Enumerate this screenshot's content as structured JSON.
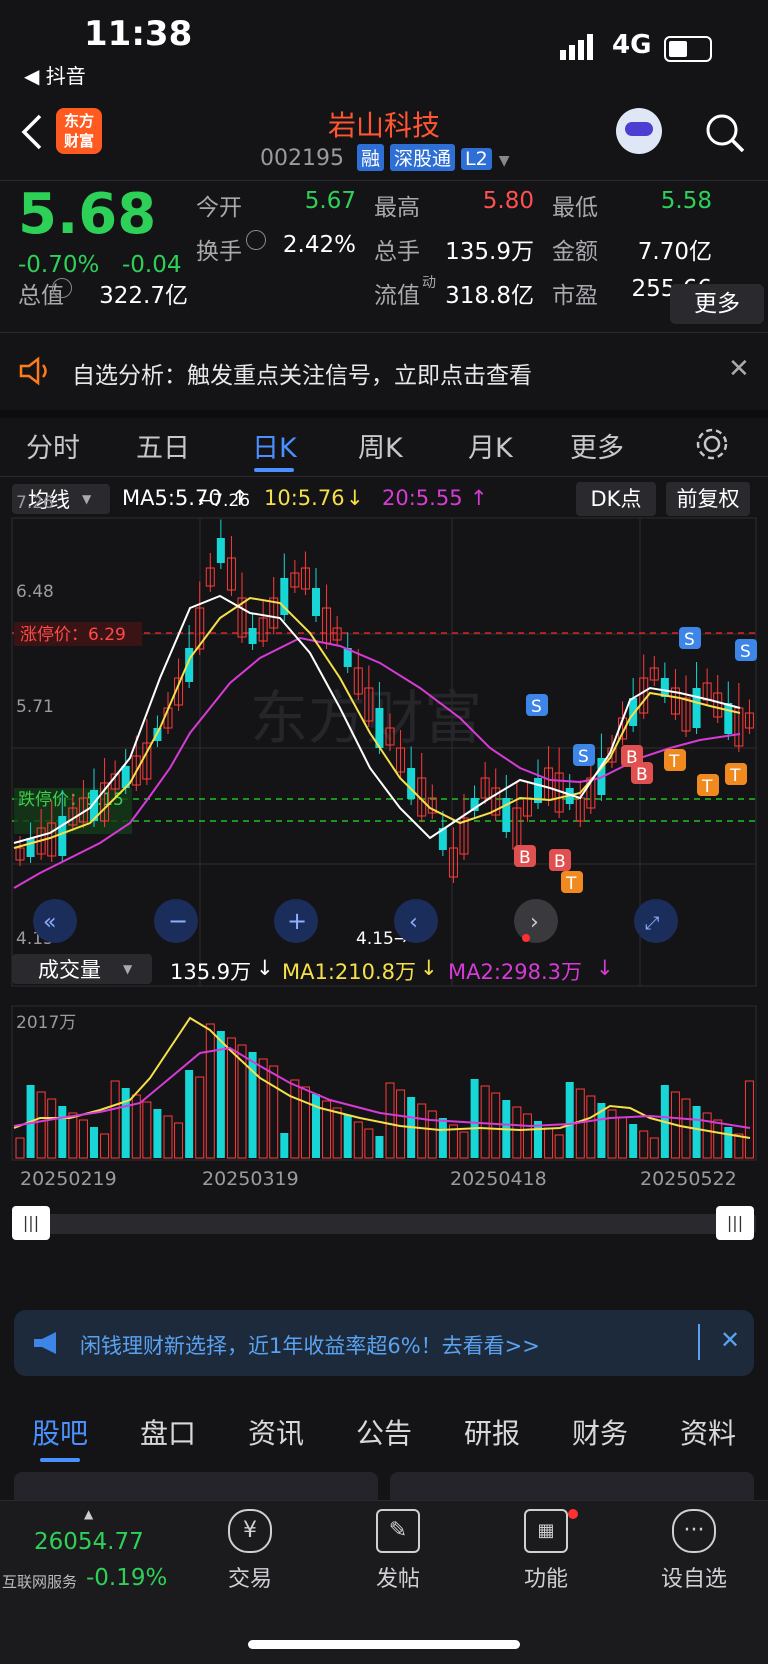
{
  "status_bar": {
    "time": "11:38",
    "back_app": "◀ 抖音",
    "network": "4G"
  },
  "header": {
    "logo_line1": "东方",
    "logo_line2": "财富",
    "stock_name": "岩山科技",
    "stock_code": "002195",
    "tags": [
      "融",
      "深股通",
      "L2"
    ]
  },
  "quote": {
    "price": "5.68",
    "change_pct": "-0.70%",
    "change_abs": "-0.04",
    "fields": [
      {
        "label": "今开",
        "value": "5.67",
        "color": "#2ed158"
      },
      {
        "label": "最高",
        "value": "5.80",
        "color": "#ff4f4f"
      },
      {
        "label": "最低",
        "value": "5.58",
        "color": "#2ed158"
      },
      {
        "label": "换手",
        "value": "2.42%",
        "color": "#ffffff"
      },
      {
        "label": "总手",
        "value": "135.9万",
        "color": "#ffffff"
      },
      {
        "label": "金额",
        "value": "7.70亿",
        "color": "#ffffff"
      },
      {
        "label": "总值",
        "value": "322.7亿",
        "color": "#ffffff"
      },
      {
        "label": "流值",
        "value": "318.8亿",
        "color": "#ffffff"
      },
      {
        "label": "市盈",
        "value": "255.66",
        "color": "#ffffff"
      }
    ],
    "pe_superscript": "动",
    "more_label": "更多"
  },
  "alert": {
    "text": "自选分析：触发重点关注信号，立即点击查看"
  },
  "kline_tabs": [
    "分时",
    "五日",
    "日K",
    "周K",
    "月K",
    "更多"
  ],
  "active_tab": "日K",
  "indicator_bar": {
    "selector": "均线",
    "ma5": "MA5:5.70",
    "ma10": "10:5.76",
    "ma20": "20:5.55",
    "dk_label": "DK点",
    "adjust_label": "前复权"
  },
  "price_axis": [
    "7.26",
    "6.48",
    "5.71",
    "4.15"
  ],
  "limit_up_label": "涨停价：6.29",
  "limit_down_label": "跌停价：5.15",
  "high_annotation": "←7.26",
  "low_annotation": "4.15→",
  "volume_bar": {
    "selector": "成交量",
    "vol": "135.9万",
    "ma1": "MA1:210.8万",
    "ma2": "MA2:298.3万",
    "axis_top": "2017万"
  },
  "date_axis": [
    "20250219",
    "20250319",
    "20250418",
    "20250522"
  ],
  "watermark": "东方财富",
  "ad": {
    "text": "闲钱理财新选择，近1年收益率超6%！去看看>>"
  },
  "bottom_tabs": [
    "股吧",
    "盘口",
    "资讯",
    "公告",
    "研报",
    "财务",
    "资料"
  ],
  "toolbar": {
    "index_value": "26054.77",
    "index_name": "互联网服务",
    "index_change": "-0.19%",
    "items": [
      "交易",
      "发帖",
      "功能",
      "设自选"
    ]
  },
  "colors": {
    "up": "#ff3b3b",
    "down": "#18d6d6",
    "ma5": "#ffffff",
    "ma10": "#f5e04a",
    "ma20": "#d63bd6"
  }
}
